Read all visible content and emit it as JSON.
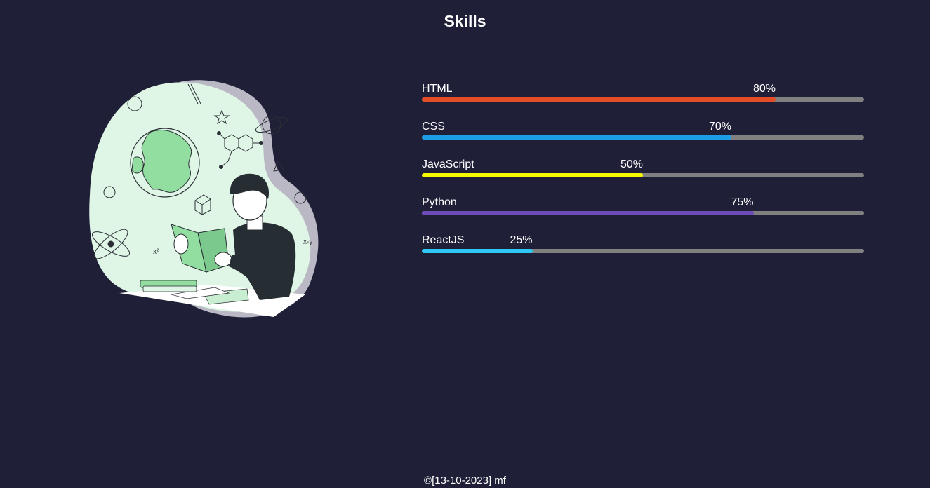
{
  "page": {
    "title": "Skills"
  },
  "skills": [
    {
      "name": "HTML",
      "percent_label": "80%",
      "value": 80,
      "color": "#e44d26"
    },
    {
      "name": "CSS",
      "percent_label": "70%",
      "value": 70,
      "color": "#1c9ee6"
    },
    {
      "name": "JavaScript",
      "percent_label": "50%",
      "value": 50,
      "color": "#f7f700"
    },
    {
      "name": "Python",
      "percent_label": "75%",
      "value": 75,
      "color": "#6e4bb8"
    },
    {
      "name": "ReactJS",
      "percent_label": "25%",
      "value": 25,
      "color": "#2ec8f5"
    }
  ],
  "track_color": "#808080",
  "background_color": "#1f1f38",
  "illustration": {
    "icon": "student-reading-illustration"
  },
  "footer": {
    "text": "©[13-10-2023] mf"
  }
}
